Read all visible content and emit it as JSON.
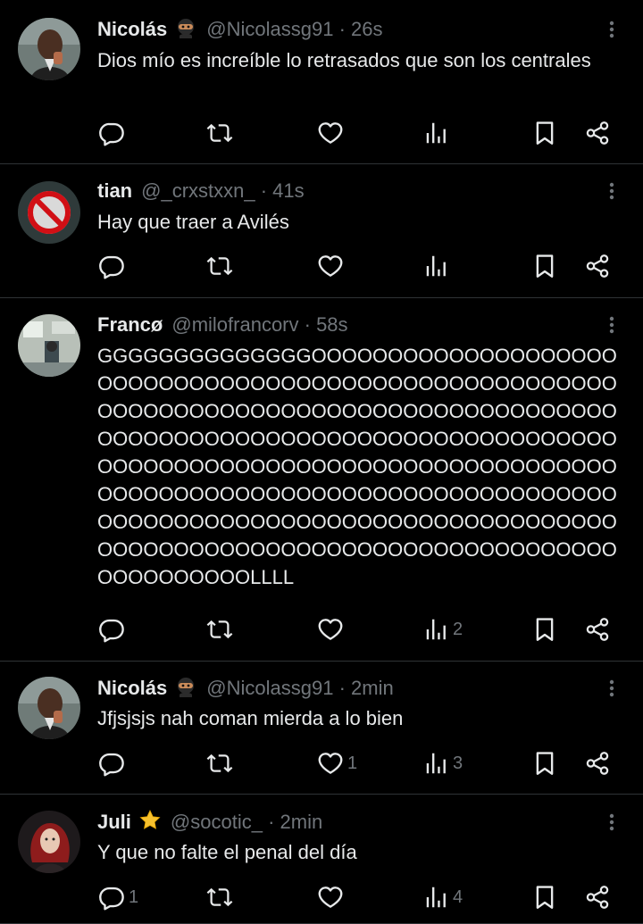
{
  "posts": [
    {
      "name": "Nicolás",
      "emoji": "ninja",
      "handle": "@Nicolassg91",
      "time": "26s",
      "text": "Dios mío es increíble lo retrasados que son los centrales",
      "replies": "",
      "retweets": "",
      "likes": "",
      "views": ""
    },
    {
      "name": "tian",
      "emoji": "",
      "handle": "@_crxstxxn_",
      "time": "41s",
      "text": "Hay que traer a Avilés",
      "replies": "",
      "retweets": "",
      "likes": "",
      "views": ""
    },
    {
      "name": "Francø",
      "emoji": "",
      "handle": "@milofrancorv",
      "time": "58s",
      "text": "GGGGGGGGGGGGGGOOOOOOOOOOOOOOOOOOOOOOOOOOOOOOOOOOOOOOOOOOOOOOOOOOOOOOOOOOOOOOOOOOOOOOOOOOOOOOOOOOOOOOOOOOOOOOOOOOOOOOOOOOOOOOOOOOOOOOOOOOOOOOOOOOOOOOOOOOOOOOOOOOOOOOOOOOOOOOOOOOOOOOOOOOOOOOOOOOOOOOOOOOOOOOOOOOOOOOOOOOOOOOOOOOOOOOOOOOOOOOOOOOOOOOOOOOOOOOOOOOOOOOOOOOOOOOOOOOOOOOOOOOOOLLLL",
      "replies": "",
      "retweets": "",
      "likes": "",
      "views": "2"
    },
    {
      "name": "Nicolás",
      "emoji": "ninja",
      "handle": "@Nicolassg91",
      "time": "2min",
      "text": "Jfjsjsjs nah coman mierda a lo bien",
      "replies": "",
      "retweets": "",
      "likes": "1",
      "views": "3"
    },
    {
      "name": "Juli",
      "emoji": "star",
      "handle": "@socotic_",
      "time": "2min",
      "text": "Y que no falte el penal del día",
      "replies": "1",
      "retweets": "",
      "likes": "",
      "views": "4"
    }
  ],
  "separator": " · ",
  "icons": {
    "reply": "reply-icon",
    "retweet": "retweet-icon",
    "like": "heart-icon",
    "views": "views-icon",
    "bookmark": "bookmark-icon",
    "share": "share-icon",
    "more": "more-vertical-icon"
  },
  "colors": {
    "background": "#000000",
    "text": "#e7e9ea",
    "muted": "#71767b",
    "divider": "#2f3336"
  }
}
